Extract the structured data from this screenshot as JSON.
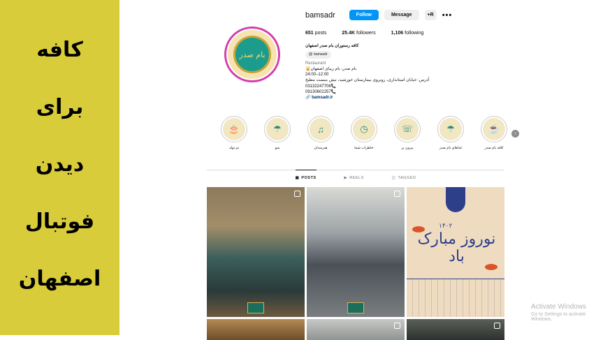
{
  "left_panel": {
    "lines": [
      "کافه",
      "برای",
      "دیدن",
      "فوتبال",
      "اصفهان"
    ],
    "background": "#d9cc3a"
  },
  "profile": {
    "username": "bamsadr",
    "follow_label": "Follow",
    "message_label": "Message",
    "add_user_icon": "+R",
    "more_label": "•••",
    "stats": {
      "posts": "651",
      "posts_label": "posts",
      "followers": "25.4K",
      "followers_label": "followers",
      "following": "1,106",
      "following_label": "following"
    },
    "display_name": "کافه رستوران بام صدر اصفهان",
    "threads_label": "bamsadr",
    "category": "Restaurant",
    "bio_lines": [
      "بام صدر، بام زیبای اصفهان🕌",
      "24:00–12:00",
      "آدرس: خیابان استانداری، روبروی بیمارستان خورشید، نبش بنبست مطبخ",
      "03132247706📞",
      "09130602257📞"
    ],
    "link": "bamsadr.ir",
    "avatar_text": "بام صدر"
  },
  "highlights": [
    {
      "label": "تم تولد",
      "icon": "🎂"
    },
    {
      "label": "منو",
      "icon": "☂"
    },
    {
      "label": "هنرمندان",
      "icon": "♫"
    },
    {
      "label": "خاطرات شما",
      "icon": "◷"
    },
    {
      "label": "بیرون بر",
      "icon": "☏"
    },
    {
      "label": "غذاهای بام صدر",
      "icon": "☂"
    },
    {
      "label": "کافه بام صدر",
      "icon": "☕"
    }
  ],
  "tabs": [
    {
      "label": "POSTS",
      "icon": "▦",
      "active": true
    },
    {
      "label": "REELS",
      "icon": "▶",
      "active": false
    },
    {
      "label": "TAGGED",
      "icon": "◫",
      "active": false
    }
  ],
  "posts": [
    {
      "kind": "reel",
      "desc": "cafe interior"
    },
    {
      "kind": "reel",
      "desc": "kitchen chef"
    },
    {
      "kind": "image",
      "desc": "nowruz card"
    },
    {
      "kind": "image",
      "desc": "food"
    },
    {
      "kind": "reel",
      "desc": "food"
    },
    {
      "kind": "reel",
      "desc": "dish"
    }
  ],
  "nowruz": {
    "text": "نوروز مبارک باد",
    "year": "۱۴۰۲"
  },
  "watermark": {
    "title": "Activate Windows",
    "subtitle": "Go to Settings to activate Windows."
  }
}
